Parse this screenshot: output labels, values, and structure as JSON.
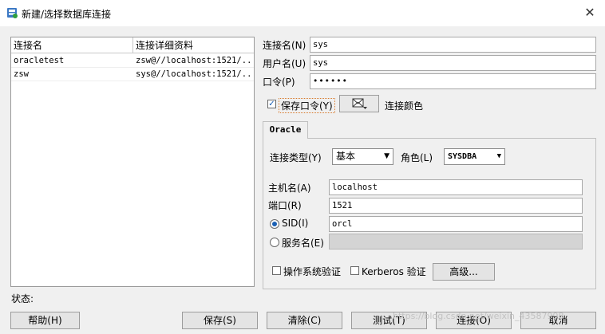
{
  "window": {
    "title": "新建/选择数据库连接",
    "close_glyph": "✕"
  },
  "connections": {
    "headers": [
      "连接名",
      "连接详细资料"
    ],
    "rows": [
      {
        "name": "oracletest",
        "details": "zsw@//localhost:1521/..."
      },
      {
        "name": "zsw",
        "details": "sys@//localhost:1521/..."
      }
    ]
  },
  "form": {
    "conn_name_label": "连接名(N)",
    "conn_name_value": "sys",
    "user_label": "用户名(U)",
    "user_value": "sys",
    "password_label": "口令(P)",
    "password_value": "••••••",
    "save_password_label": "保存口令(Y)",
    "save_password_checked": true,
    "conn_color_label": "连接颜色"
  },
  "oracle_tab": {
    "tab_label": "Oracle",
    "conn_type_label": "连接类型(Y)",
    "conn_type_value": "基本",
    "role_label": "角色(L)",
    "role_value": "SYSDBA",
    "host_label": "主机名(A)",
    "host_value": "localhost",
    "port_label": "端口(R)",
    "port_value": "1521",
    "sid_label": "SID(I)",
    "sid_value": "orcl",
    "sid_selected": true,
    "service_label": "服务名(E)",
    "service_value": "",
    "os_auth_label": "操作系统验证",
    "kerberos_label": "Kerberos 验证",
    "advanced_label": "高级..."
  },
  "status_label": "状态:",
  "buttons": {
    "help": "帮助(H)",
    "save": "保存(S)",
    "clear": "清除(C)",
    "test": "测试(T)",
    "connect": "连接(O)",
    "cancel": "取消"
  },
  "watermark": "https://blog.csdn.net/weixin_43587998",
  "icons": {
    "app": "database-connection-icon",
    "color": "envelope-color-icon"
  }
}
